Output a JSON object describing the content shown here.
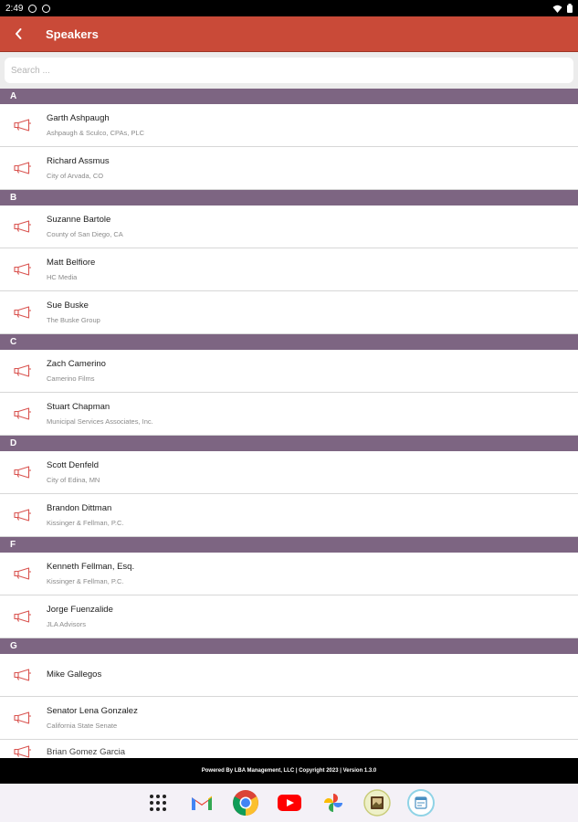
{
  "status_bar": {
    "time": "2:49"
  },
  "app_bar": {
    "title": "Speakers"
  },
  "search": {
    "placeholder": "Search ..."
  },
  "sections": [
    {
      "letter": "A",
      "speakers": [
        {
          "name": "Garth Ashpaugh",
          "org": "Ashpaugh & Sculco, CPAs, PLC"
        },
        {
          "name": "Richard Assmus",
          "org": "City of Arvada, CO"
        }
      ]
    },
    {
      "letter": "B",
      "speakers": [
        {
          "name": "Suzanne Bartole",
          "org": "County of San Diego, CA"
        },
        {
          "name": "Matt Belfiore",
          "org": "HC Media"
        },
        {
          "name": "Sue Buske",
          "org": "The Buske Group"
        }
      ]
    },
    {
      "letter": "C",
      "speakers": [
        {
          "name": "Zach Camerino",
          "org": "Camerino Films"
        },
        {
          "name": "Stuart Chapman",
          "org": "Municipal Services Associates, Inc."
        }
      ]
    },
    {
      "letter": "D",
      "speakers": [
        {
          "name": "Scott Denfeld",
          "org": "City of Edina, MN"
        },
        {
          "name": "Brandon Dittman",
          "org": "Kissinger & Fellman, P.C."
        }
      ]
    },
    {
      "letter": "F",
      "speakers": [
        {
          "name": "Kenneth Fellman, Esq.",
          "org": "Kissinger & Fellman, P.C."
        },
        {
          "name": "Jorge Fuenzalide",
          "org": "JLA Advisors"
        }
      ]
    },
    {
      "letter": "G",
      "speakers": [
        {
          "name": "Mike  Gallegos",
          "org": ""
        },
        {
          "name": "Senator Lena Gonzalez",
          "org": "California State Senate"
        }
      ]
    }
  ],
  "partial_item": {
    "name": "Brian Gomez Garcia"
  },
  "footer": {
    "text": "Powered By LBA Management, LLC | Copyright 2023 | Version 1.3.0"
  },
  "dock": [
    {
      "name": "app-drawer",
      "icon": "grid-icon"
    },
    {
      "name": "gmail",
      "icon": "gmail-icon"
    },
    {
      "name": "chrome",
      "icon": "chrome-icon"
    },
    {
      "name": "youtube",
      "icon": "youtube-icon"
    },
    {
      "name": "photos",
      "icon": "pinwheel-icon"
    },
    {
      "name": "gallery",
      "icon": "picture-frame-icon"
    },
    {
      "name": "calendar-app",
      "icon": "calendar-icon"
    }
  ],
  "colors": {
    "app_bar": "#c94a38",
    "section_header": "#7d6582",
    "speaker_icon": "#d9534f"
  }
}
